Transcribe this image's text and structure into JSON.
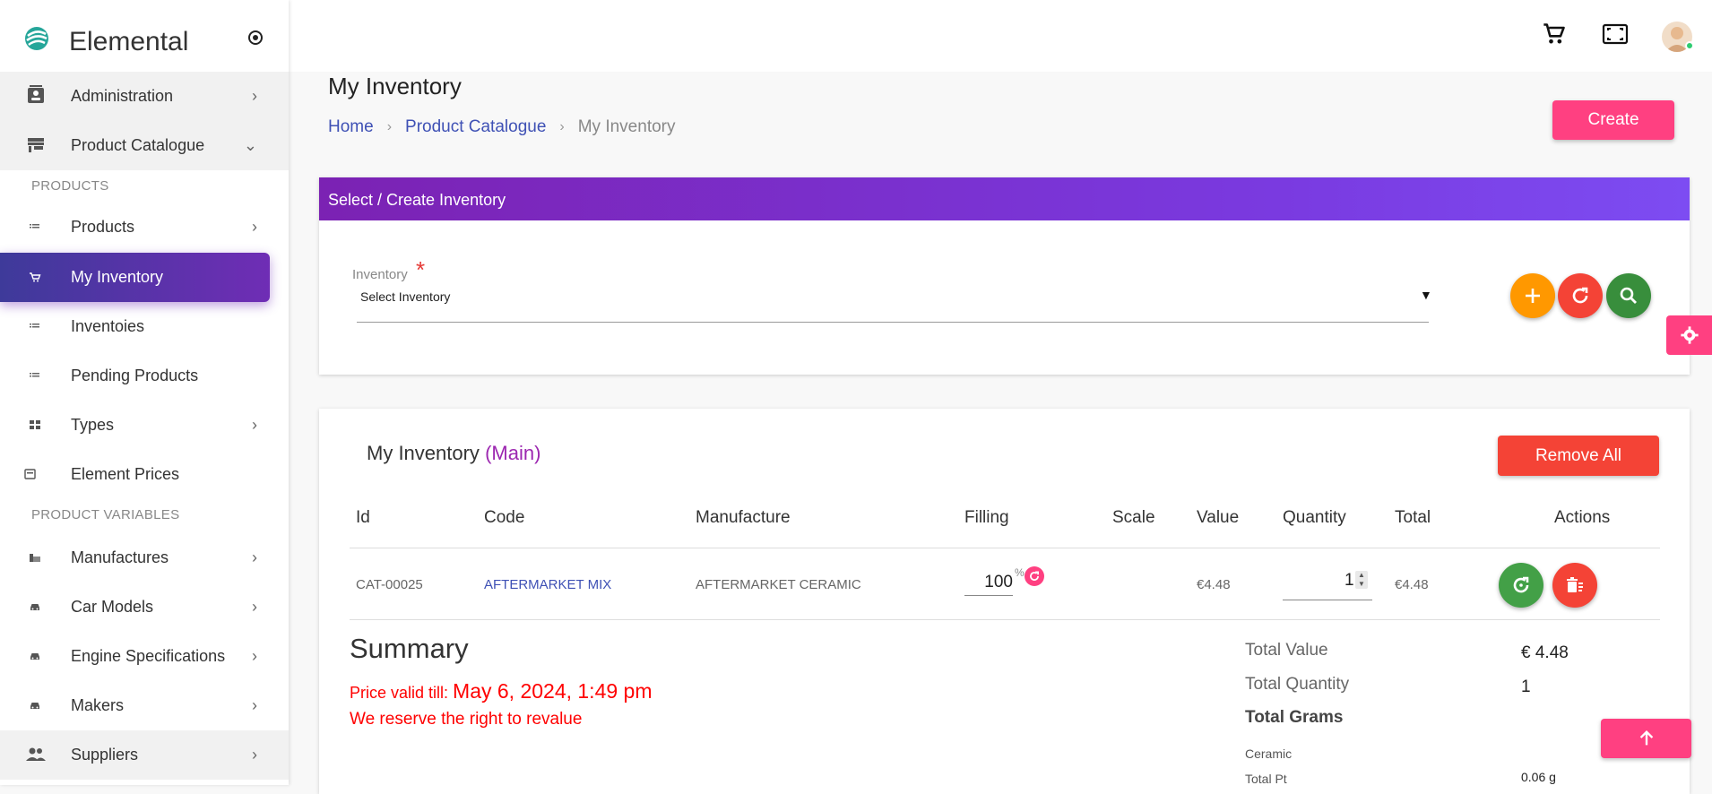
{
  "brand": {
    "name": "Elemental"
  },
  "sidebar": {
    "items": [
      {
        "label": "Administration",
        "icon": "contact-card-icon",
        "chevron": "›"
      },
      {
        "label": "Product Catalogue",
        "icon": "store-icon",
        "chevron": "⌄"
      },
      {
        "label": "Products",
        "icon": "list-icon",
        "chevron": "›"
      },
      {
        "label": "My Inventory",
        "icon": "cart-icon",
        "chevron": ""
      },
      {
        "label": "Inventoies",
        "icon": "list-icon",
        "chevron": ""
      },
      {
        "label": "Pending Products",
        "icon": "list-icon",
        "chevron": ""
      },
      {
        "label": "Types",
        "icon": "grid-icon",
        "chevron": "›"
      },
      {
        "label": "Element Prices",
        "icon": "price-icon",
        "chevron": ""
      },
      {
        "label": "Manufactures",
        "icon": "factory-icon",
        "chevron": "›"
      },
      {
        "label": "Car Models",
        "icon": "car-icon",
        "chevron": "›"
      },
      {
        "label": "Engine Specifications",
        "icon": "car-icon",
        "chevron": "›"
      },
      {
        "label": "Makers",
        "icon": "car-icon",
        "chevron": "›"
      },
      {
        "label": "Suppliers",
        "icon": "people-icon",
        "chevron": "›"
      }
    ],
    "sections": {
      "products": "PRODUCTS",
      "product_variables": "PRODUCT VARIABLES"
    }
  },
  "page": {
    "title": "My Inventory",
    "breadcrumb": {
      "home": "Home",
      "catalogue": "Product Catalogue",
      "current": "My Inventory",
      "separator": "›"
    },
    "create_label": "Create"
  },
  "select_card": {
    "header": "Select / Create Inventory",
    "field_label": "Inventory",
    "required_mark": "*",
    "selected_value": "Select Inventory",
    "caret": "▼"
  },
  "inventory": {
    "title": "My Inventory",
    "subtitle": "(Main)",
    "remove_all_label": "Remove All",
    "columns": [
      "Id",
      "Code",
      "Manufacture",
      "Filling",
      "Scale",
      "Value",
      "Quantity",
      "Total",
      "Actions"
    ],
    "row": {
      "id": "CAT-00025",
      "code": "AFTERMARKET MIX",
      "manufacture": "AFTERMARKET CERAMIC",
      "filling": "100",
      "filling_unit": "%",
      "scale": "",
      "value": "€4.48",
      "quantity": "1",
      "total": "€4.48"
    }
  },
  "summary": {
    "title": "Summary",
    "price_valid_prefix": "Price valid till: ",
    "price_valid_date": "May 6, 2024, 1:49 pm",
    "reserve_note": "We reserve the right to revalue",
    "total_value_label": "Total Value",
    "total_value": "€ 4.48",
    "total_quantity_label": "Total Quantity",
    "total_quantity": "1",
    "total_grams_label": "Total Grams",
    "ceramic_label": "Ceramic",
    "total_pt_label": "Total Pt",
    "total_pt_value": "0.06 g"
  },
  "colors": {
    "accent_pink": "#ff4081",
    "primary_purple": "#6f2db5",
    "link_blue": "#3f51b5",
    "danger_red": "#f44336",
    "add_orange": "#ff9800",
    "search_green": "#388e3c",
    "refresh_green": "#43a047"
  }
}
